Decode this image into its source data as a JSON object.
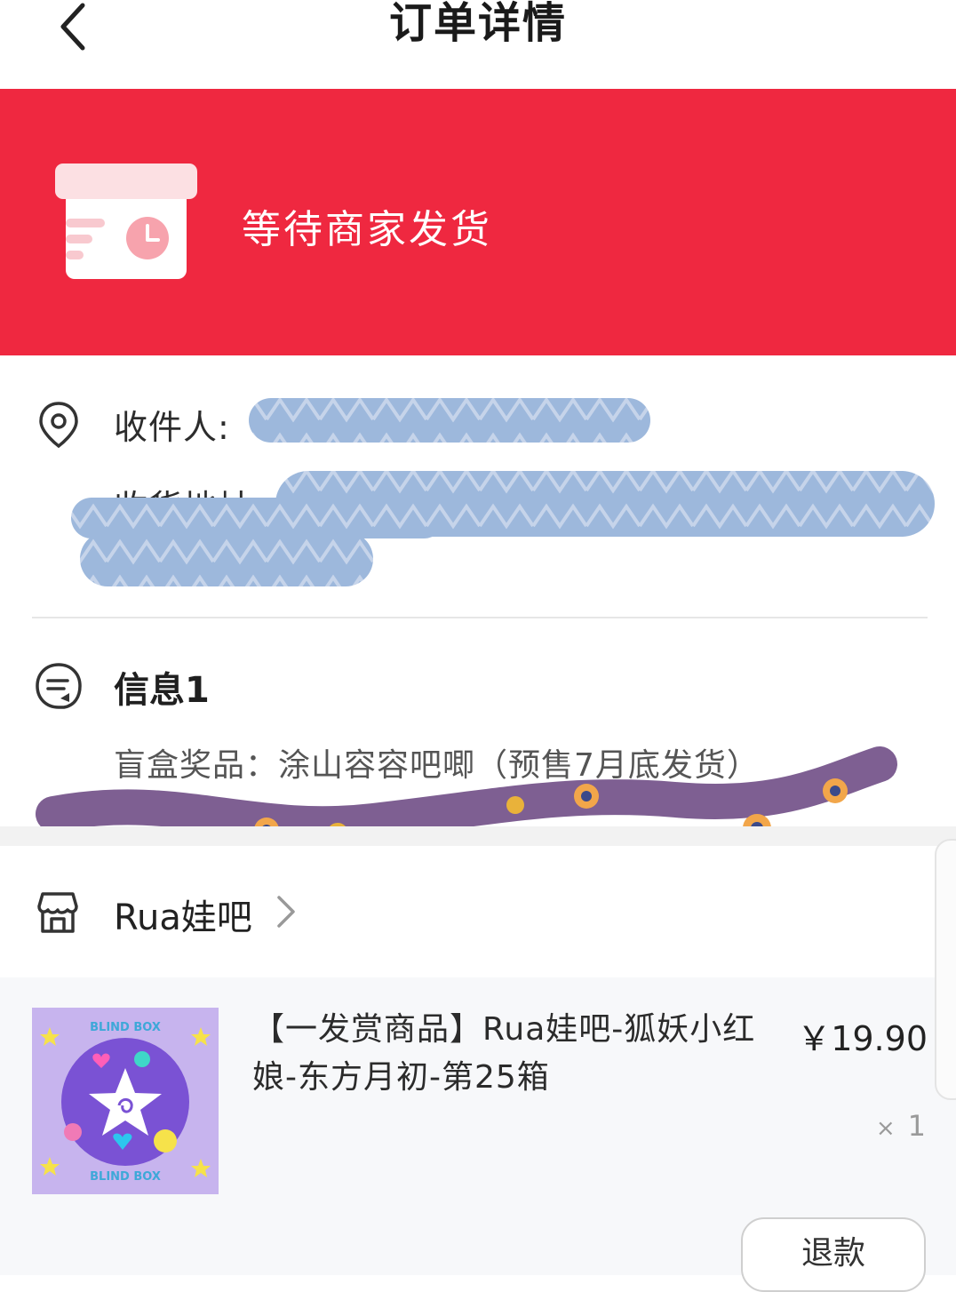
{
  "header": {
    "title": "订单详情",
    "back_icon": "chevron-left-icon"
  },
  "status": {
    "text": "等待商家发货",
    "background_color": "#ef2840",
    "icon": "package-clock-icon"
  },
  "address": {
    "recipient_label": "收件人:",
    "address_label": "收货地址:",
    "location_icon": "location-pin-icon"
  },
  "message": {
    "title": "信息1",
    "content": "盲盒奖品：涂山容容吧唧（预售7月底发货）",
    "icon": "message-icon"
  },
  "shop": {
    "name": "Rua娃吧",
    "icon": "shop-icon"
  },
  "product": {
    "title": "【一发赏商品】Rua娃吧-狐妖小红娘-东方月初-第25箱",
    "price": "￥19.90",
    "quantity_prefix": "×",
    "quantity": "1",
    "image_text_top": "BLIND BOX",
    "image_text_bottom": "BLIND BOX"
  },
  "actions": {
    "refund_label": "退款"
  }
}
